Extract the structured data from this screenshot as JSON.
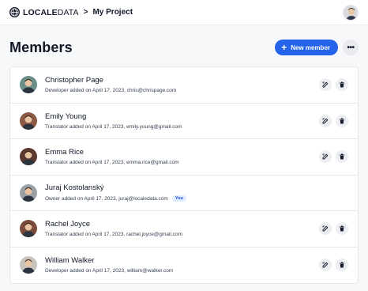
{
  "topbar": {
    "brand_strong": "LOCALE",
    "brand_light": "DATA",
    "separator": ">",
    "project": "My Project"
  },
  "header": {
    "title": "Members",
    "new_button": "New member",
    "more_icon": "ellipsis-icon"
  },
  "members": [
    {
      "name": "Christopher Page",
      "meta": "Developer added on April 17, 2023, chris@chrispage.com",
      "badge": "",
      "avatar_color": "#6b8f8a",
      "actions": true
    },
    {
      "name": "Emily Young",
      "meta": "Translator added on April 17, 2023, emily.young@gmail.com",
      "badge": "",
      "avatar_color": "#8a5a44",
      "actions": true
    },
    {
      "name": "Emma Rice",
      "meta": "Translator added on April 17, 2023, emma.rice@gmail.com",
      "badge": "",
      "avatar_color": "#5a3a30",
      "actions": true
    },
    {
      "name": "Juraj Kostolanský",
      "meta": "Owner added on April 17, 2023, juraj@localedata.com",
      "badge": "You",
      "avatar_color": "#9aa0a6",
      "actions": false
    },
    {
      "name": "Rachel Joyce",
      "meta": "Translator added on April 17, 2023, rachel.joyce@gmail.com",
      "badge": "",
      "avatar_color": "#7a4b3b",
      "actions": true
    },
    {
      "name": "William Walker",
      "meta": "Developer added on April 17, 2023, william@walker.com",
      "badge": "",
      "avatar_color": "#c9c3bd",
      "actions": true
    }
  ],
  "colors": {
    "accent": "#2563eb",
    "border": "#e5e7eb"
  }
}
